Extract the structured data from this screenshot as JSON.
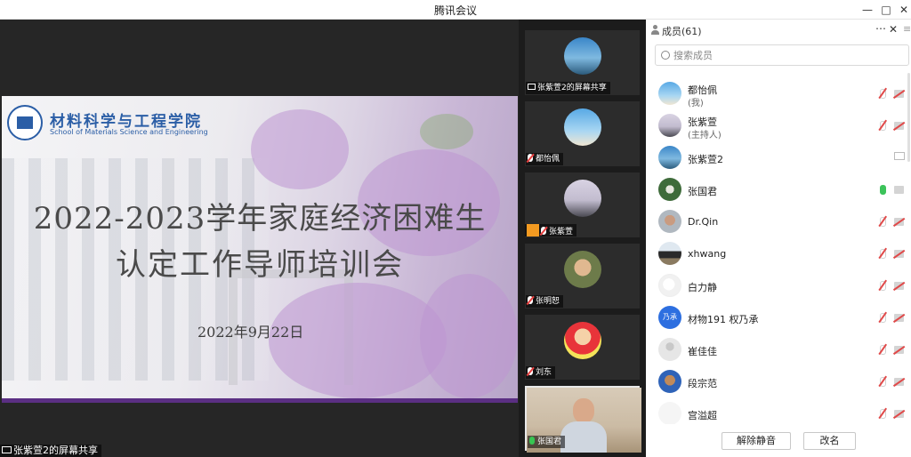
{
  "window": {
    "title": "腾讯会议"
  },
  "slide": {
    "school_cn": "材料科学与工程学院",
    "school_en": "School of Materials Science and Engineering",
    "title_line1": "2022-2023学年家庭经济困难生",
    "title_line2": "认定工作导师培训会",
    "date": "2022年9月22日"
  },
  "share_label": "张紫萱2的屏幕共享",
  "video_tiles": [
    {
      "name": "张紫萱2的屏幕共享",
      "type": "screen"
    },
    {
      "name": "都怡佩",
      "type": "muted"
    },
    {
      "name": "张紫萱",
      "type": "host-muted"
    },
    {
      "name": "张明恕",
      "type": "muted"
    },
    {
      "name": "刘东",
      "type": "muted"
    },
    {
      "name": "张国君",
      "type": "speaking"
    }
  ],
  "panel": {
    "title": "成员(61)",
    "search_placeholder": "搜索成员",
    "members": [
      {
        "name": "都怡佩",
        "sub": "(我)",
        "mic": "off"
      },
      {
        "name": "张紫萱",
        "sub": "(主持人)",
        "mic": "off"
      },
      {
        "name": "张紫萱2",
        "sub": "",
        "mic": "screen"
      },
      {
        "name": "张国君",
        "sub": "",
        "mic": "on"
      },
      {
        "name": "Dr.Qin",
        "sub": "",
        "mic": "off"
      },
      {
        "name": "xhwang",
        "sub": "",
        "mic": "off"
      },
      {
        "name": "白力静",
        "sub": "",
        "mic": "off"
      },
      {
        "name": "材物191 权乃承",
        "sub": "",
        "mic": "off",
        "avatar_text": "乃承"
      },
      {
        "name": "崔佳佳",
        "sub": "",
        "mic": "off"
      },
      {
        "name": "段宗范",
        "sub": "",
        "mic": "off"
      },
      {
        "name": "宫溢超",
        "sub": "",
        "mic": "off"
      }
    ],
    "unmute_all_label": "解除静音",
    "rename_label": "改名"
  },
  "colors": {
    "accent": "#2b5ea6",
    "slide_bar": "#5b2f83",
    "mic_on": "#37c552",
    "mic_off": "#e04a4a"
  }
}
